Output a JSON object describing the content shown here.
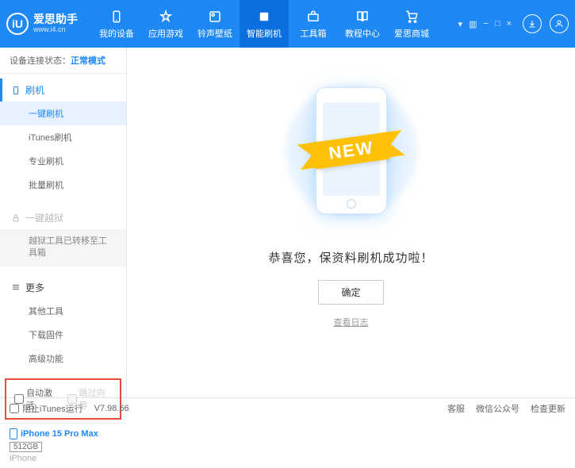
{
  "header": {
    "logo_letter": "iU",
    "logo_title": "爱思助手",
    "logo_url": "www.i4.cn",
    "nav": [
      {
        "label": "我的设备"
      },
      {
        "label": "应用游戏"
      },
      {
        "label": "铃声壁纸"
      },
      {
        "label": "智能刷机"
      },
      {
        "label": "工具箱"
      },
      {
        "label": "教程中心"
      },
      {
        "label": "爱思商城"
      }
    ]
  },
  "sidebar": {
    "conn_label": "设备连接状态：",
    "conn_mode": "正常模式",
    "flash_head": "刷机",
    "flash_items": [
      "一键刷机",
      "iTunes刷机",
      "专业刷机",
      "批量刷机"
    ],
    "jailbreak_head": "一键越狱",
    "jailbreak_note": "越狱工具已转移至工具箱",
    "more_head": "更多",
    "more_items": [
      "其他工具",
      "下载固件",
      "高级功能"
    ],
    "cb_auto": "自动激活",
    "cb_skip": "跳过向导",
    "device_name": "iPhone 15 Pro Max",
    "device_storage": "512GB",
    "device_type": "iPhone"
  },
  "main": {
    "ribbon": "NEW",
    "success": "恭喜您，保资料刷机成功啦！",
    "ok": "确定",
    "log": "查看日志"
  },
  "footer": {
    "block_itunes": "阻止iTunes运行",
    "version": "V7.98.66",
    "links": [
      "客服",
      "微信公众号",
      "检查更新"
    ]
  }
}
